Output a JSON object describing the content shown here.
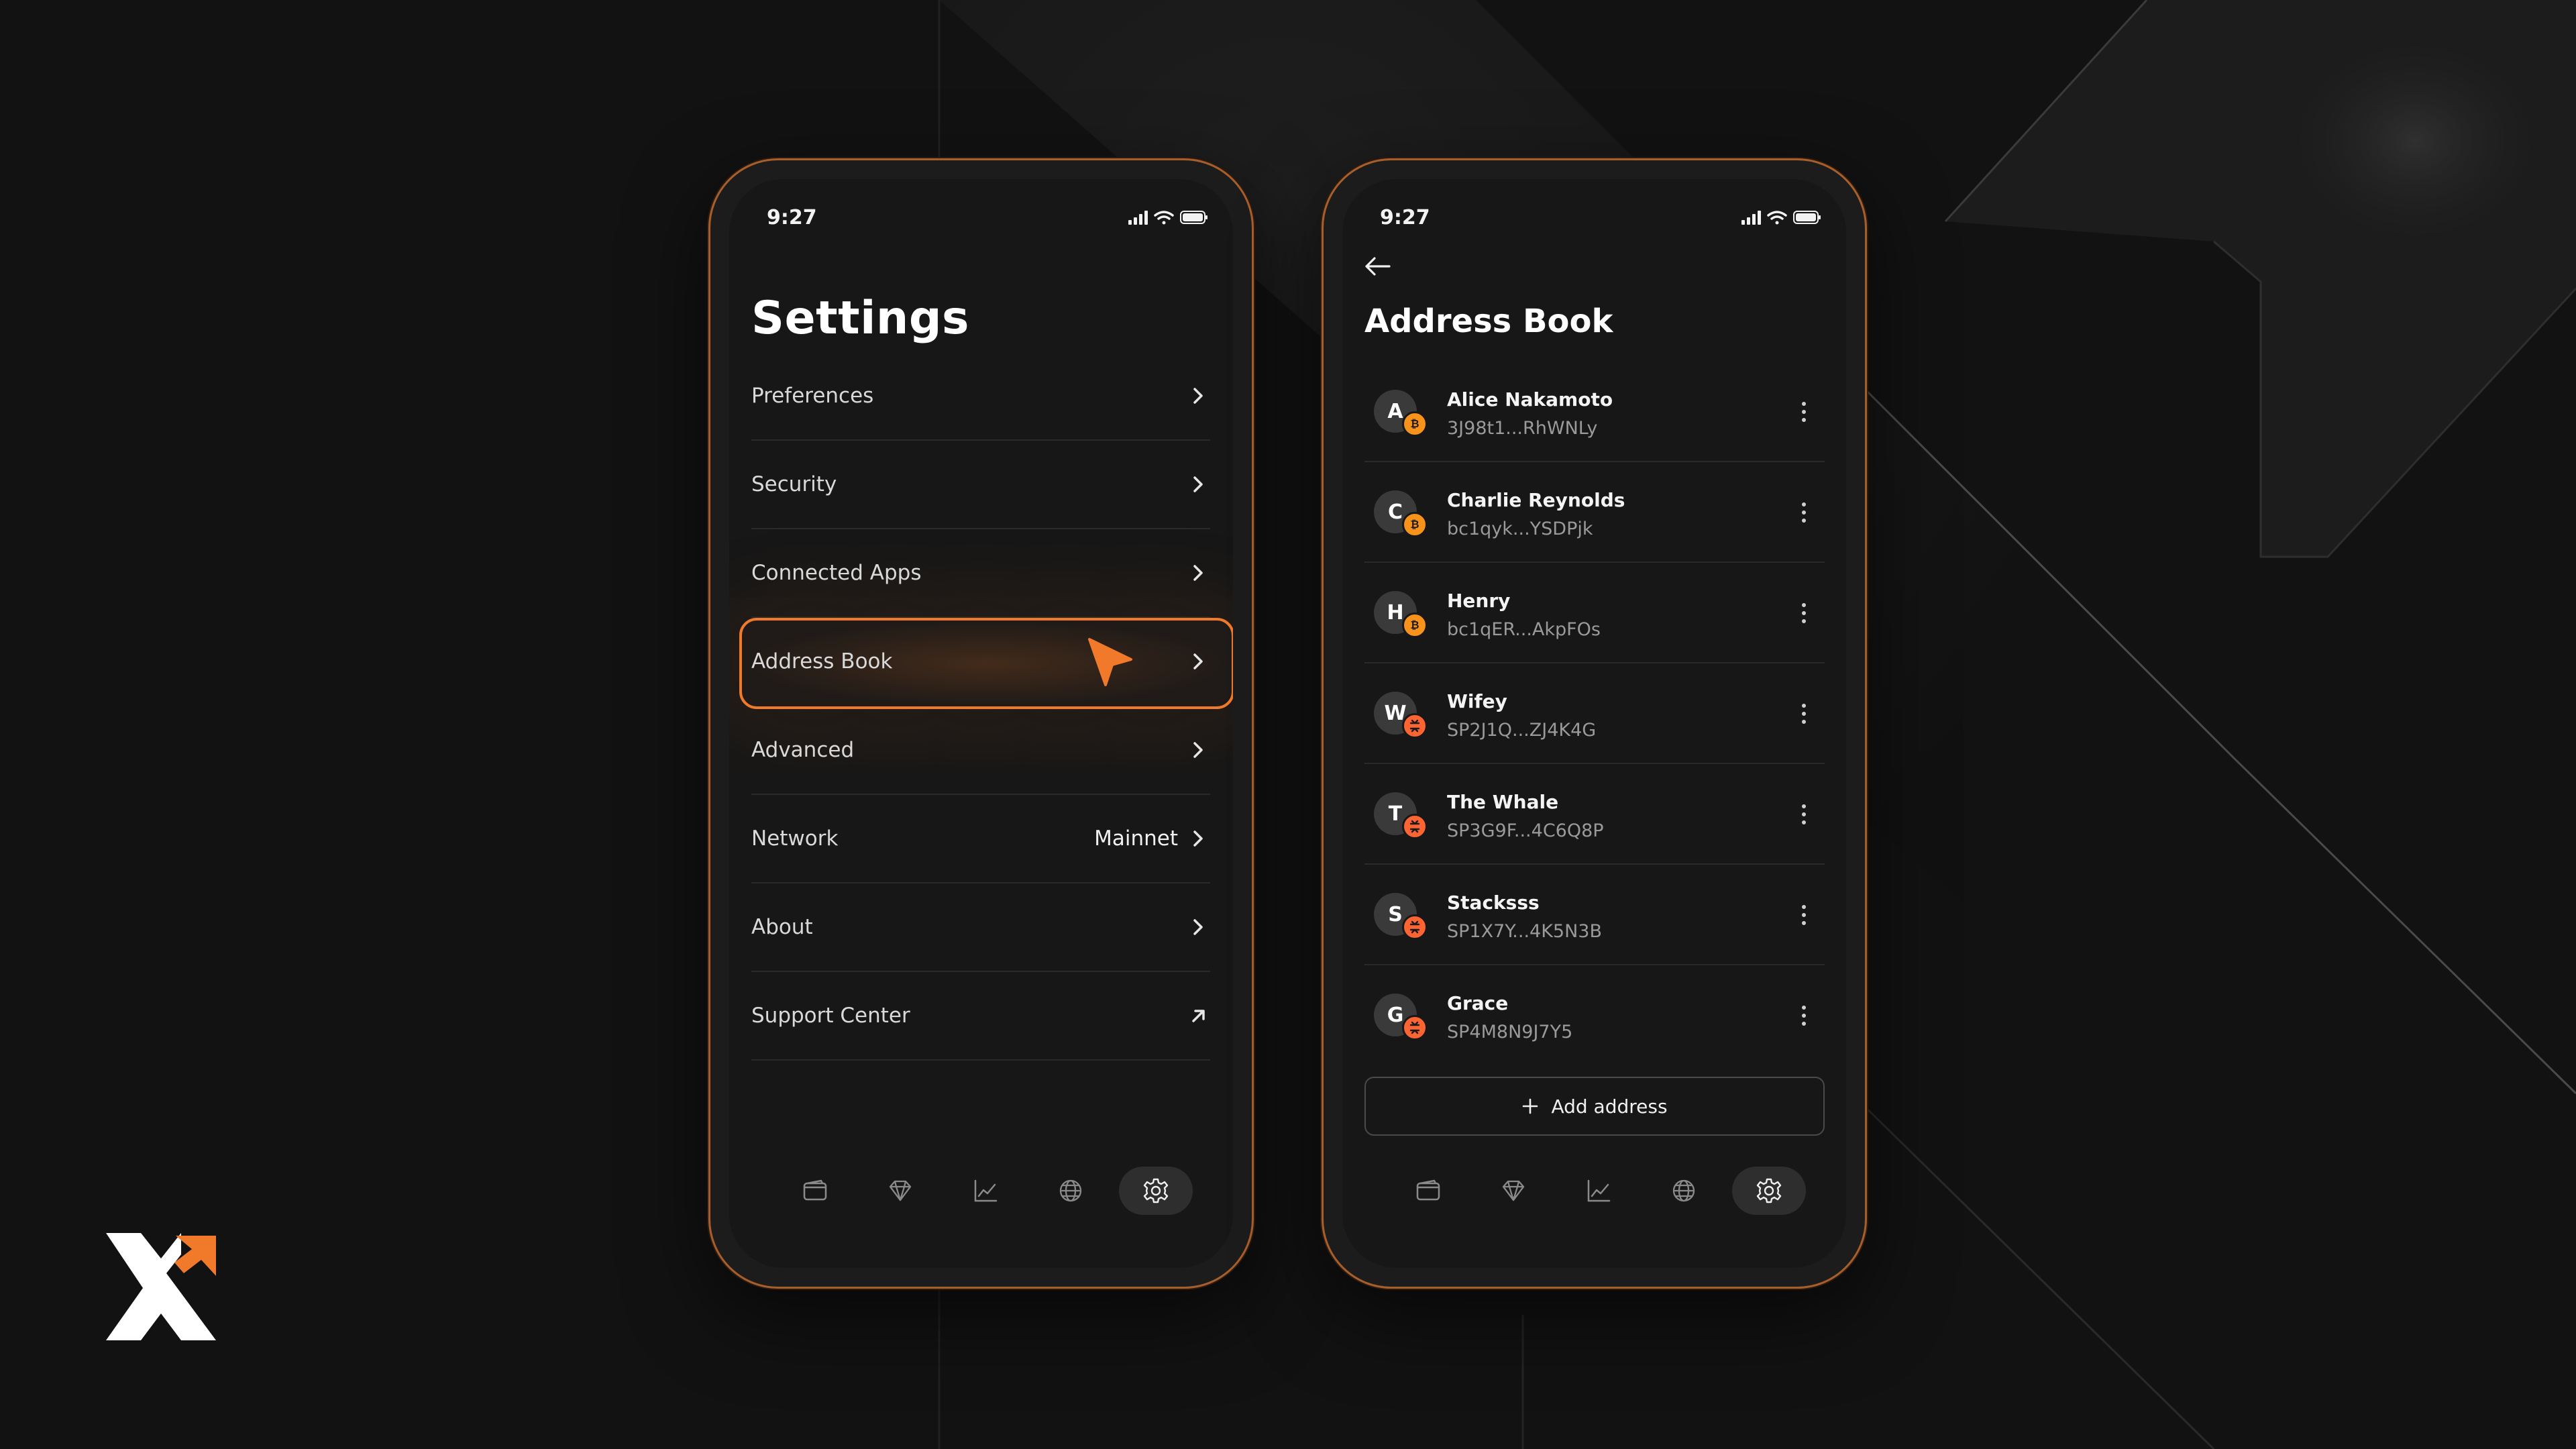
{
  "colors": {
    "accent": "#f07a2a",
    "background": "#121212",
    "screen": "#171717",
    "bitcoin": "#f7931a",
    "stacks": "#fc6432"
  },
  "left_screen": {
    "status": {
      "time": "9:27",
      "icons": [
        "signal-icon",
        "wifi-icon",
        "battery-icon"
      ]
    },
    "title": "Settings",
    "items": [
      {
        "label": "Preferences",
        "value": "",
        "trailing": "chevron-right-icon"
      },
      {
        "label": "Security",
        "value": "",
        "trailing": "chevron-right-icon"
      },
      {
        "label": "Connected Apps",
        "value": "",
        "trailing": "chevron-right-icon"
      },
      {
        "label": "Address Book",
        "value": "",
        "trailing": "chevron-right-icon",
        "highlighted": true
      },
      {
        "label": "Advanced",
        "value": "",
        "trailing": "chevron-right-icon"
      },
      {
        "label": "Network",
        "value": "Mainnet",
        "trailing": "chevron-right-icon"
      },
      {
        "label": "About",
        "value": "",
        "trailing": "chevron-right-icon"
      },
      {
        "label": "Support Center",
        "value": "",
        "trailing": "external-link-icon"
      }
    ]
  },
  "right_screen": {
    "status": {
      "time": "9:27",
      "icons": [
        "signal-icon",
        "wifi-icon",
        "battery-icon"
      ]
    },
    "title": "Address Book",
    "contacts": [
      {
        "initial": "A",
        "name": "Alice Nakamoto",
        "address": "3J98t1...RhWNLy",
        "coin": "bitcoin"
      },
      {
        "initial": "C",
        "name": "Charlie Reynolds",
        "address": "bc1qyk...YSDPjk",
        "coin": "bitcoin"
      },
      {
        "initial": "H",
        "name": "Henry",
        "address": "bc1qER...AkpFOs",
        "coin": "bitcoin"
      },
      {
        "initial": "W",
        "name": "Wifey",
        "address": "SP2J1Q...ZJ4K4G",
        "coin": "stacks"
      },
      {
        "initial": "T",
        "name": "The Whale",
        "address": "SP3G9F...4C6Q8P",
        "coin": "stacks"
      },
      {
        "initial": "S",
        "name": "Stacksss",
        "address": "SP1X7Y...4K5N3B",
        "coin": "stacks"
      },
      {
        "initial": "G",
        "name": "Grace",
        "address": "SP4M8N9J7Y5",
        "coin": "stacks"
      }
    ],
    "add_button_label": "Add address"
  },
  "tabbar": {
    "tabs": [
      "wallet-icon",
      "diamond-icon",
      "chart-icon",
      "globe-icon",
      "gear-icon"
    ],
    "active": "gear-icon"
  }
}
